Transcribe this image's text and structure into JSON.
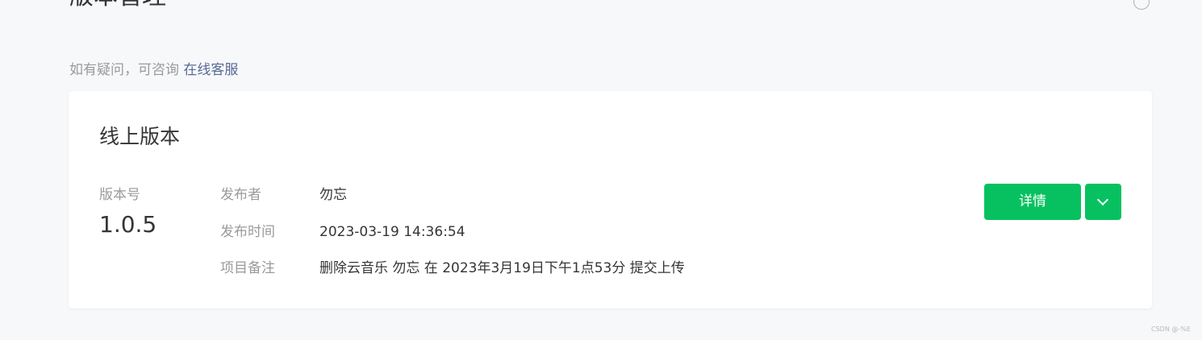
{
  "header": {
    "page_title": "版本管理",
    "help_icon": "question-circle-icon"
  },
  "hint": {
    "text": "如有疑问，可咨询",
    "link_label": "在线客服"
  },
  "card": {
    "title": "线上版本",
    "version_label": "版本号",
    "version_number": "1.0.5",
    "fields": [
      {
        "label": "发布者",
        "value": "勿忘"
      },
      {
        "label": "发布时间",
        "value": "2023-03-19 14:36:54"
      },
      {
        "label": "项目备注",
        "value": "删除云音乐 勿忘 在 2023年3月19日下午1点53分 提交上传"
      }
    ],
    "detail_button_label": "详情",
    "dropdown_icon": "chevron-down-icon"
  },
  "watermark": "CSDN @-%E",
  "colors": {
    "accent": "#07c160",
    "link": "#576b95",
    "background": "#f7f8fa",
    "muted_text": "#9a9a9a"
  }
}
